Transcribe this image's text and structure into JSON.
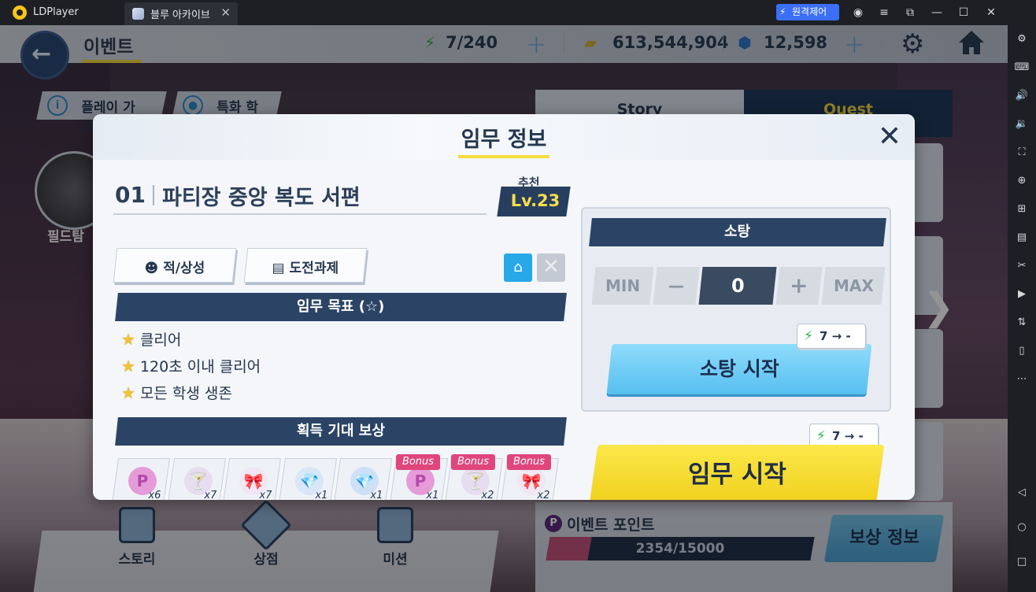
{
  "titlebar": {
    "app_name": "LDPlayer",
    "tab_title": "블루 아카이브",
    "tab_close": "✕",
    "remote_label": "원격제어",
    "icons": [
      "account-icon",
      "menu-icon",
      "restore-down-icon",
      "minimize-icon",
      "maximize-icon",
      "close-icon"
    ]
  },
  "sidebar": {
    "icons": [
      "settings-icon",
      "keyboard-icon",
      "volume-up-icon",
      "volume-down-icon",
      "screenshot-icon",
      "add-apk-icon",
      "multi-instance-icon",
      "install-apk-icon",
      "scissors-icon",
      "record-icon",
      "sync-icon",
      "shake-icon",
      "more-icon",
      "back-icon",
      "home-icon",
      "recent-apps-icon"
    ]
  },
  "hud": {
    "page_title": "이벤트",
    "ap": "7/240",
    "credits": "613,544,904",
    "pyroxene": "12,598"
  },
  "background": {
    "play_guide": "플레이 가이드",
    "special_student": "특화 학생",
    "field_label": "필드탐",
    "tab_story": "Story",
    "tab_quest": "Quest",
    "nav_story": "스토리",
    "nav_shop": "상점",
    "nav_mission": "미션",
    "event_point_label": "이벤트 포인트",
    "event_point_value": "2354/15000",
    "event_point_progress": 0.157,
    "reward_info": "보상 정보"
  },
  "dialog": {
    "title": "임무 정보",
    "stage_number": "01",
    "stage_name": "파티장 중앙 복도 서편",
    "recommend_label": "추천",
    "recommend_level": "Lv.23",
    "enemy_button": "적/상성",
    "challenge_button": "도전과제",
    "goal_header": "임무 목표 (☆)",
    "goals": [
      "클리어",
      "120초 이내 클리어",
      "모든 학생 생존"
    ],
    "reward_header": "획득 기대 보상",
    "rewards": [
      {
        "qty": "x6",
        "bonus": false,
        "icon": "P",
        "kind": "point"
      },
      {
        "qty": "x7",
        "bonus": false,
        "icon": "🍸",
        "kind": "glass"
      },
      {
        "qty": "x7",
        "bonus": false,
        "icon": "🎀",
        "kind": "ribbon"
      },
      {
        "qty": "x1",
        "bonus": false,
        "icon": "💎",
        "kind": "crystal"
      },
      {
        "qty": "x1",
        "bonus": false,
        "icon": "💎",
        "kind": "crystal-blue"
      },
      {
        "qty": "x1",
        "bonus": true,
        "icon": "P",
        "kind": "point"
      },
      {
        "qty": "x2",
        "bonus": true,
        "icon": "🍸",
        "kind": "glass"
      },
      {
        "qty": "x2",
        "bonus": true,
        "icon": "🎀",
        "kind": "ribbon"
      }
    ],
    "bonus_label": "Bonus",
    "sweep": {
      "header": "소탕",
      "min": "MIN",
      "minus": "—",
      "count": "0",
      "plus": "+",
      "max": "MAX",
      "cost": "7 → -",
      "button": "소탕 시작"
    },
    "start_cost": "7 → -",
    "start_button": "임무 시작"
  },
  "colors": {
    "navy": "#2b4466",
    "yellow": "#f6dd4b",
    "sky": "#56bff0",
    "bonus_pink": "#e0457c"
  }
}
